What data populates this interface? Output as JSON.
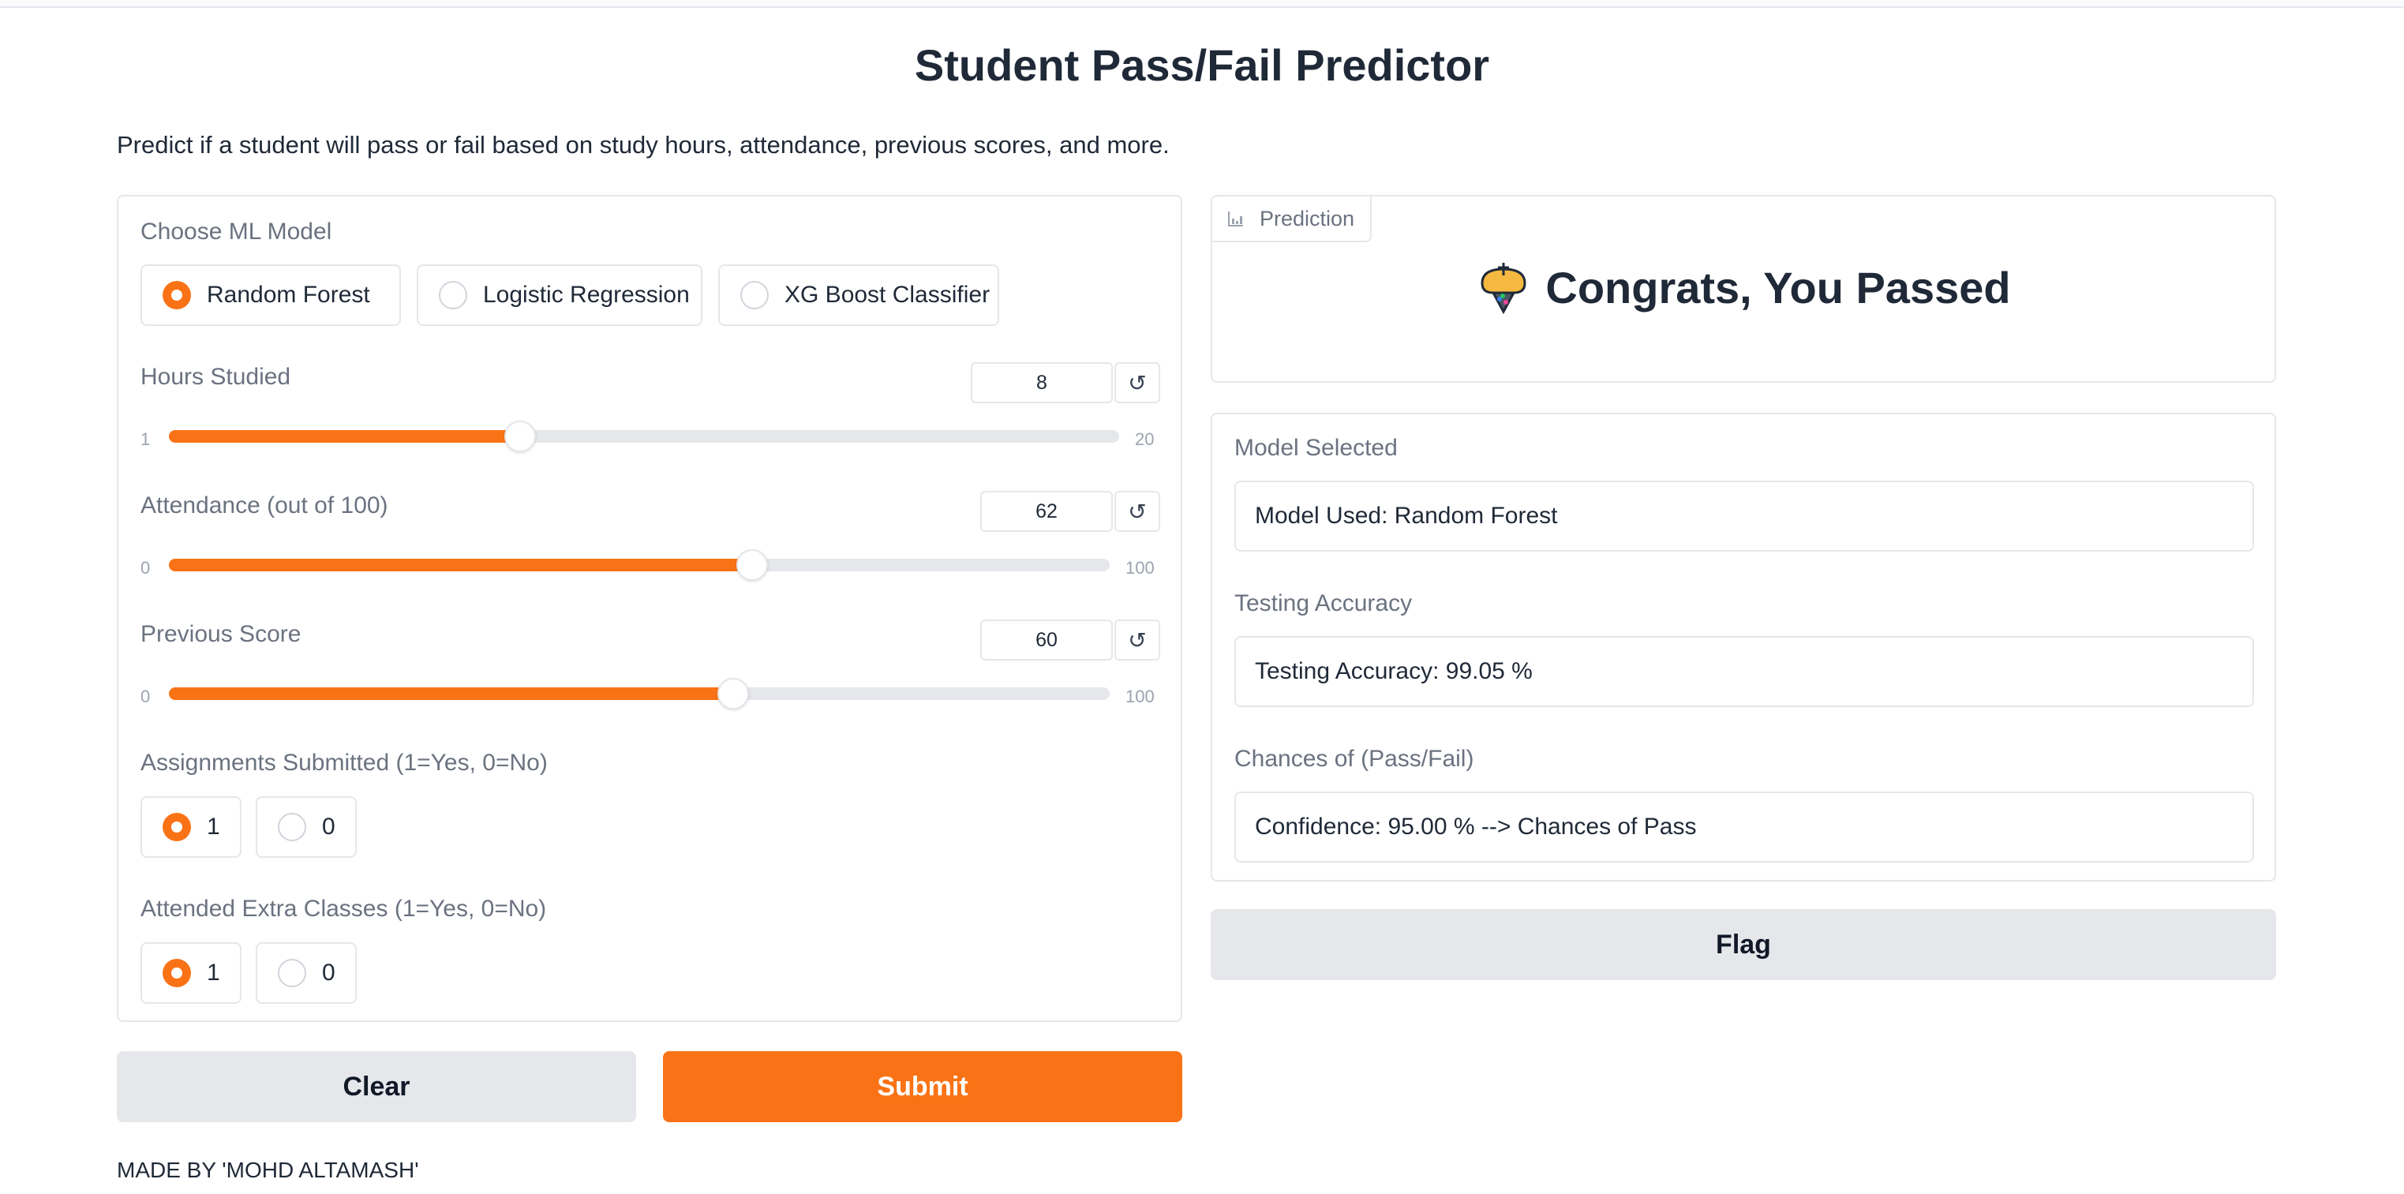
{
  "page": {
    "title": "Student Pass/Fail Predictor",
    "description": "Predict if a student will pass or fail based on study hours, attendance, previous scores, and more.",
    "footer": "MADE BY 'MOHD ALTAMASH'"
  },
  "accent_color": "#f97316",
  "model_choice": {
    "label": "Choose ML Model",
    "options": [
      "Random Forest",
      "Logistic Regression",
      "XG Boost Classifier"
    ],
    "selected": "Random Forest"
  },
  "sliders": {
    "hours": {
      "label": "Hours Studied",
      "min": "1",
      "max": "20",
      "value": "8",
      "reset_icon": "reset-icon"
    },
    "attendance": {
      "label": "Attendance (out of 100)",
      "min": "0",
      "max": "100",
      "value": "62",
      "reset_icon": "reset-icon"
    },
    "previous": {
      "label": "Previous Score",
      "min": "0",
      "max": "100",
      "value": "60",
      "reset_icon": "reset-icon"
    }
  },
  "assignments": {
    "label": "Assignments Submitted (1=Yes, 0=No)",
    "options": [
      "1",
      "0"
    ],
    "selected": "1"
  },
  "extra_classes": {
    "label": "Attended Extra Classes (1=Yes, 0=No)",
    "options": [
      "1",
      "0"
    ],
    "selected": "1"
  },
  "buttons": {
    "clear": "Clear",
    "submit": "Submit",
    "flag": "Flag"
  },
  "prediction": {
    "tag": "Prediction",
    "tag_icon": "bar-chart-icon",
    "result_icon": "party-popper-icon",
    "result": "Congrats, You Passed"
  },
  "outputs": {
    "model_label": "Model Selected",
    "model_value": "Model Used: Random Forest",
    "accuracy_label": "Testing Accuracy",
    "accuracy_value": "Testing Accuracy: 99.05 %",
    "chances_label": "Chances of (Pass/Fail)",
    "chances_value": "Confidence: 95.00 % --> Chances of Pass"
  }
}
